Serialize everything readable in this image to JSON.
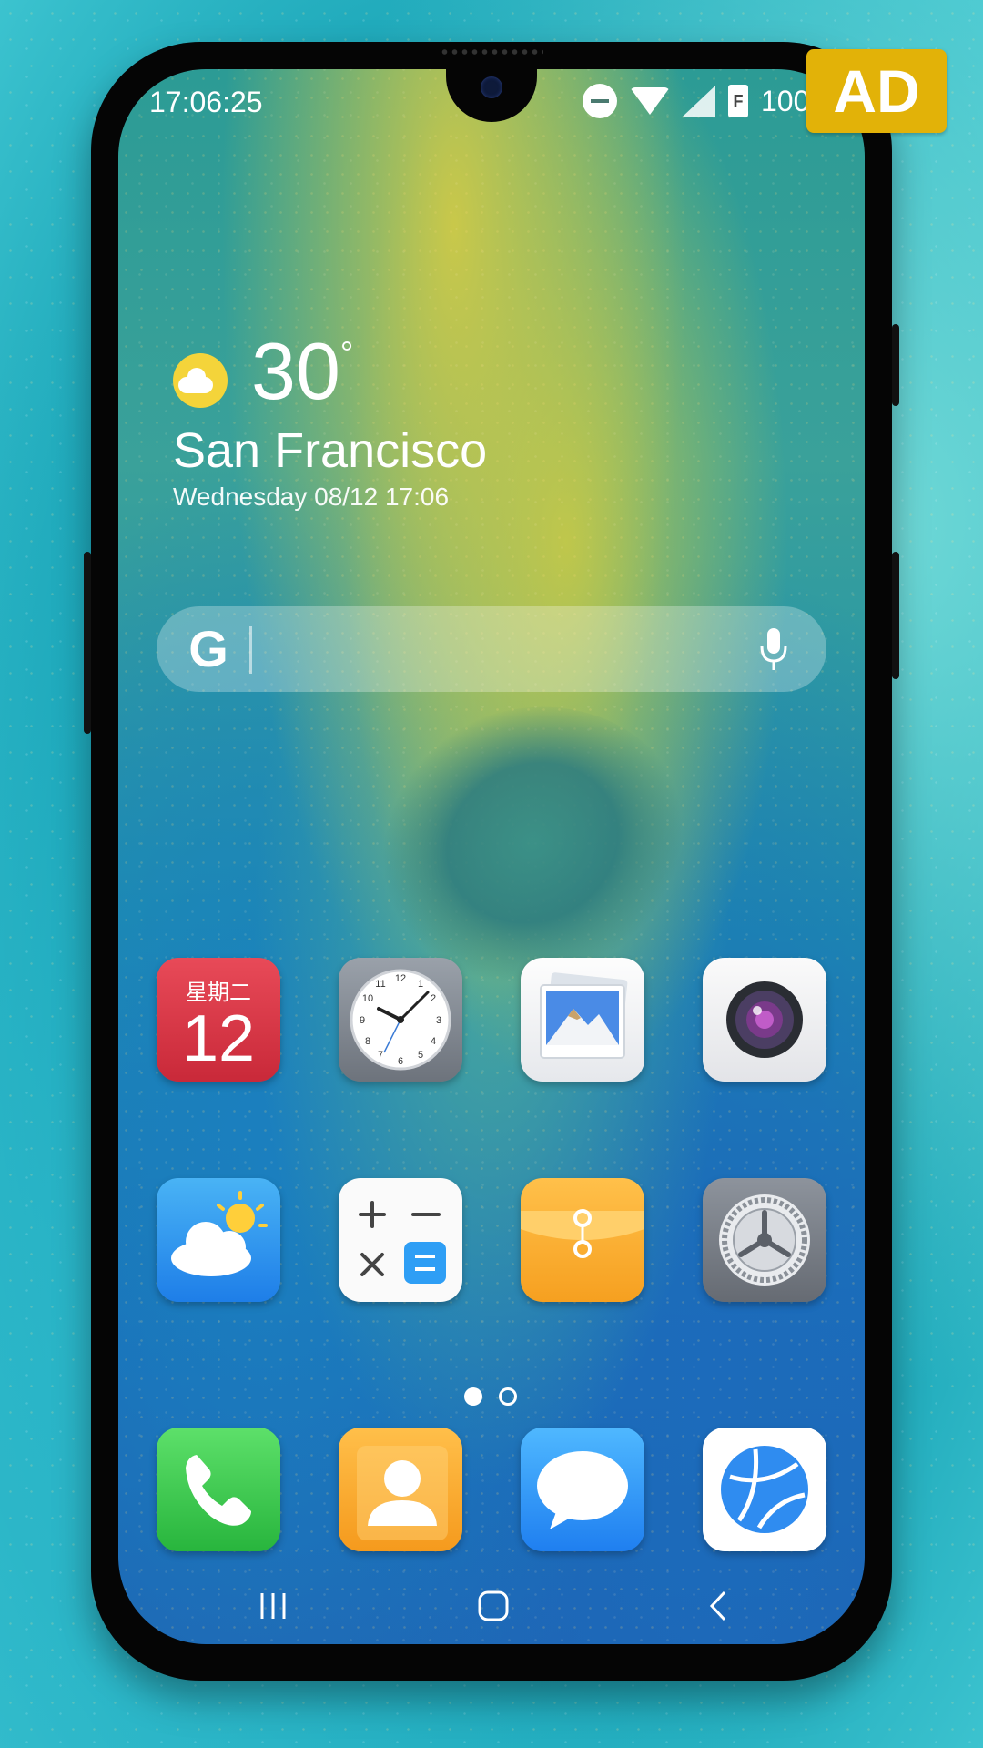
{
  "status_bar": {
    "time": "17:06:25",
    "battery_letter": "F",
    "battery_text": "100"
  },
  "ad_badge": "AD",
  "weather_widget": {
    "temperature": "30",
    "degree_symbol": "°",
    "city": "San Francisco",
    "date": "Wednesday 08/12 17:06"
  },
  "search_bar": {
    "logo": "G"
  },
  "apps_row1": [
    {
      "name": "calendar",
      "weekday": "星期二",
      "day": "12"
    },
    {
      "name": "clock"
    },
    {
      "name": "gallery"
    },
    {
      "name": "camera"
    }
  ],
  "apps_row2": [
    {
      "name": "weather"
    },
    {
      "name": "calculator"
    },
    {
      "name": "file-manager"
    },
    {
      "name": "settings"
    }
  ],
  "dock": [
    {
      "name": "phone"
    },
    {
      "name": "contacts"
    },
    {
      "name": "messages"
    },
    {
      "name": "browser"
    }
  ],
  "page_indicator": {
    "current": 1,
    "total": 2
  },
  "nav_bar": [
    "recents",
    "home",
    "back"
  ],
  "colors": {
    "ad_badge": "#e2b208",
    "calendar": "#d93546",
    "phone": "#3ccb4f",
    "contacts": "#f7a726",
    "messages": "#2a8cf5"
  }
}
